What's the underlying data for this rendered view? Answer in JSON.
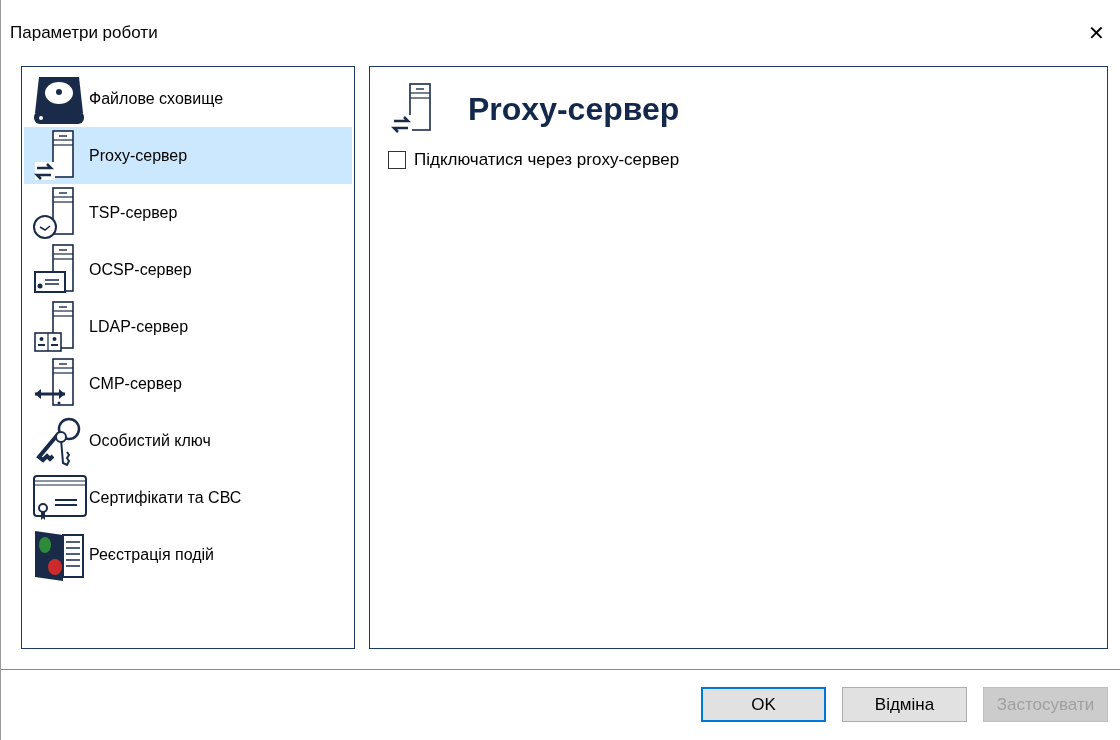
{
  "window": {
    "title": "Параметри роботи",
    "close": "✕"
  },
  "sidebar": {
    "items": [
      {
        "label": "Файлове сховище",
        "selected": false
      },
      {
        "label": "Proxy-сервер",
        "selected": true
      },
      {
        "label": "TSP-сервер",
        "selected": false
      },
      {
        "label": "OCSP-сервер",
        "selected": false
      },
      {
        "label": "LDAP-сервер",
        "selected": false
      },
      {
        "label": "CMP-сервер",
        "selected": false
      },
      {
        "label": "Особистий ключ",
        "selected": false
      },
      {
        "label": "Сертифікати та СВС",
        "selected": false
      },
      {
        "label": "Реєстрація подій",
        "selected": false
      }
    ]
  },
  "panel": {
    "title": "Proxy-сервер",
    "checkbox": {
      "label": "Підключатися через proxy-сервер",
      "checked": false
    }
  },
  "buttons": [
    {
      "label": "OK",
      "default": true,
      "disabled": false
    },
    {
      "label": "Відміна",
      "default": false,
      "disabled": false
    },
    {
      "label": "Застосувати",
      "default": false,
      "disabled": true
    }
  ]
}
